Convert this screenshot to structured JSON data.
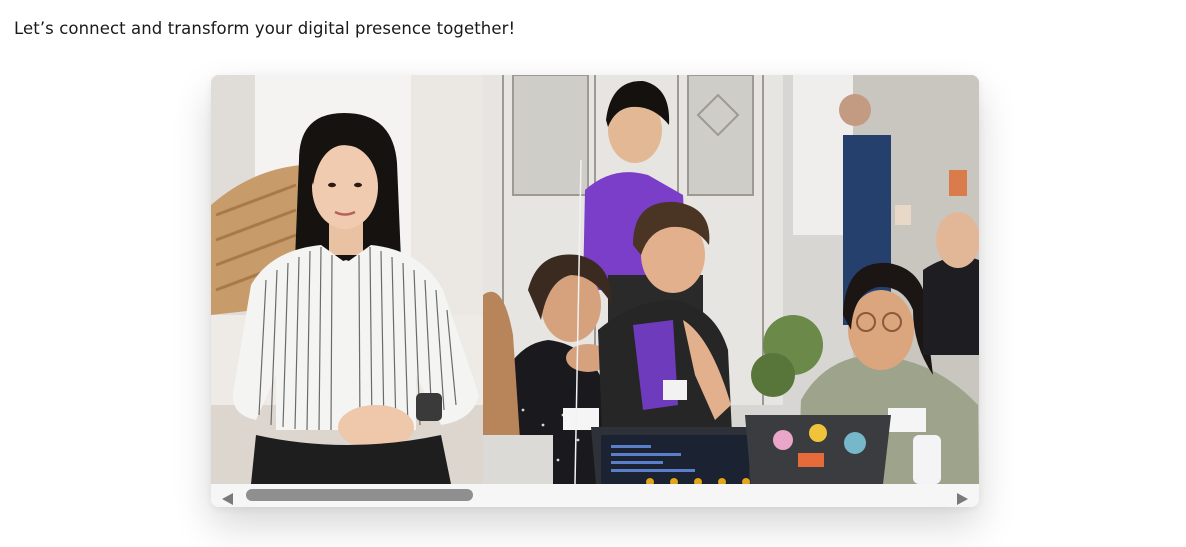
{
  "header": {
    "tagline": "Let’s connect and transform your digital presence together!"
  },
  "carousel": {
    "slides": [
      {
        "image": "portrait-woman-striped-shirt"
      },
      {
        "image": "team-working-on-laptops"
      }
    ],
    "dots": 5,
    "icons": {
      "prev": "triangle-left-icon",
      "next": "triangle-right-icon"
    },
    "colors": {
      "dot": "#e3a51a",
      "thumb": "#8f8f8f",
      "track": "#f6f6f6",
      "arrow": "#7a7a7a"
    }
  }
}
